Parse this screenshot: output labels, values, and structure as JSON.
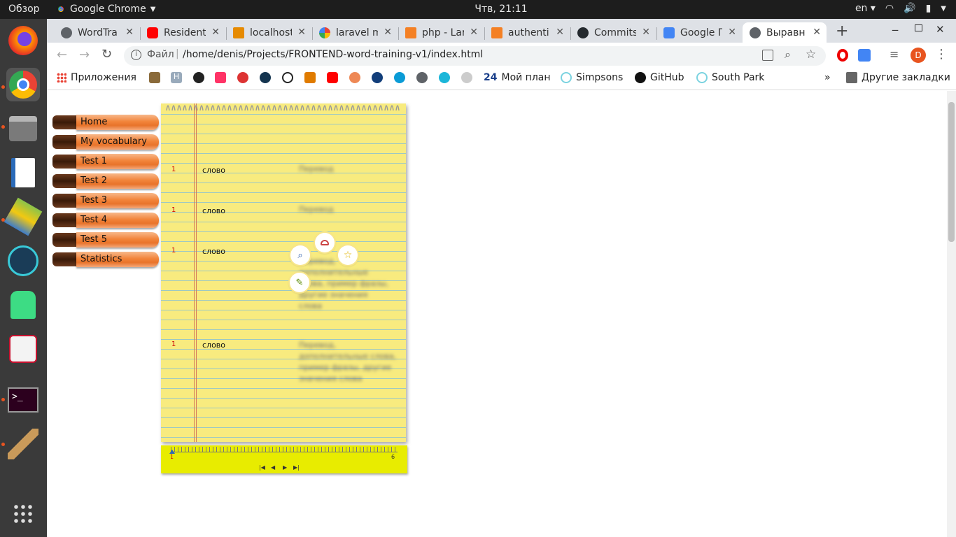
{
  "system_bar": {
    "activities": "Обзор",
    "app_name": "Google Chrome",
    "clock": "Чтв, 21:11",
    "lang": "en"
  },
  "tabs": [
    {
      "title": "WordTra",
      "color": "#5f6368"
    },
    {
      "title": "Resident",
      "color": "#ff0000"
    },
    {
      "title": "localhost",
      "color": "#e68a00"
    },
    {
      "title": "laravel m",
      "color": "#4285f4"
    },
    {
      "title": "php - Lar",
      "color": "#f48024"
    },
    {
      "title": "authenti",
      "color": "#f48024"
    },
    {
      "title": "Commits",
      "color": "#24292e"
    },
    {
      "title": "Google Г",
      "color": "#4285f4"
    },
    {
      "title": "Выравн",
      "color": "#5f6368"
    }
  ],
  "address": {
    "scheme_label": "Файл",
    "url": "/home/denis/Projects/FRONTEND-word-training-v1/index.html",
    "profile_initial": "D"
  },
  "bookmarks": {
    "apps": "Приложения",
    "myplan_num": "24",
    "myplan": "Мой план",
    "simpsons": "Simpsons",
    "github": "GitHub",
    "southpark": "South Park",
    "more": "»",
    "other": "Другие закладки"
  },
  "menu": [
    "Home",
    "My vocabulary",
    "Test 1",
    "Test 2",
    "Test 3",
    "Test 4",
    "Test 5",
    "Statistics"
  ],
  "words": [
    {
      "num": "1",
      "word": "слово",
      "translation": "Перевод"
    },
    {
      "num": "1",
      "word": "слово",
      "translation": "Перевод"
    },
    {
      "num": "1",
      "word": "слово",
      "translation": "Перевод, дополнительные слова, пример фразы, другие значения слова"
    },
    {
      "num": "1",
      "word": "слово",
      "translation": "Перевод, дополнительные слова, пример фразы, другие значения слова"
    }
  ],
  "ruler": {
    "start": "1",
    "end": "6",
    "position": "1"
  },
  "colors": {
    "accent": "#f2843a",
    "notepad": "#f8eb7f",
    "ruler": "#e8ec00",
    "chrome_tabstrip": "#dee1e6"
  }
}
